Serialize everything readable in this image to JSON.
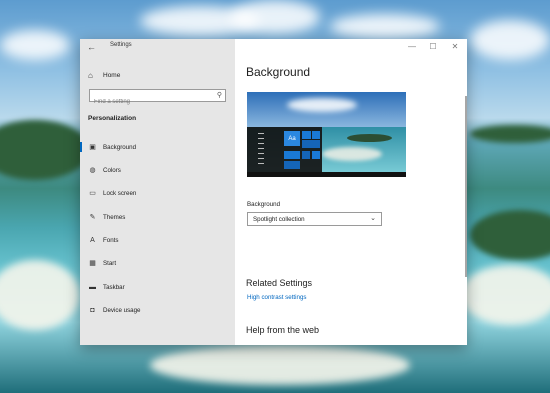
{
  "window": {
    "title": "Settings",
    "back_glyph": "←",
    "minimize_glyph": "—",
    "maximize_glyph": "☐",
    "close_glyph": "✕"
  },
  "sidebar": {
    "home": {
      "icon": "home-icon",
      "glyph": "⌂",
      "label": "Home"
    },
    "search": {
      "placeholder": "Find a setting",
      "icon": "search-icon",
      "glyph": "⚲"
    },
    "section_title": "Personalization",
    "items": [
      {
        "icon": "picture-icon",
        "glyph": "▣",
        "label": "Background",
        "active": true
      },
      {
        "icon": "palette-icon",
        "glyph": "◍",
        "label": "Colors"
      },
      {
        "icon": "lock-screen-icon",
        "glyph": "▭",
        "label": "Lock screen"
      },
      {
        "icon": "brush-icon",
        "glyph": "✎",
        "label": "Themes"
      },
      {
        "icon": "font-icon",
        "glyph": "A",
        "label": "Fonts"
      },
      {
        "icon": "start-icon",
        "glyph": "▦",
        "label": "Start"
      },
      {
        "icon": "taskbar-icon",
        "glyph": "▬",
        "label": "Taskbar"
      },
      {
        "icon": "device-usage-icon",
        "glyph": "◘",
        "label": "Device usage"
      }
    ]
  },
  "main": {
    "title": "Background",
    "preview_tile_text": "Aa",
    "background_label": "Background",
    "background_value": "Spotlight collection",
    "dropdown_glyph": "⌄",
    "related_title": "Related Settings",
    "related_link": "High contrast settings",
    "help_title": "Help from the web"
  },
  "colors": {
    "accent": "#0067c0",
    "sidebar_bg": "#e6e6e6",
    "content_bg": "#ffffff"
  }
}
